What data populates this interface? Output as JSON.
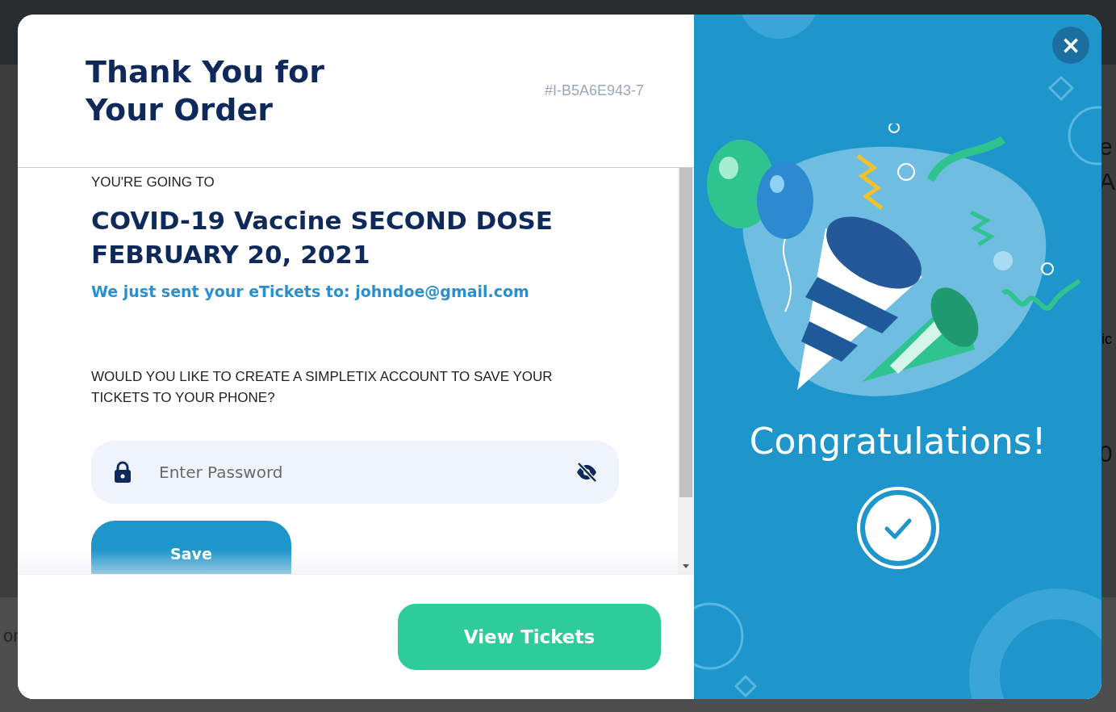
{
  "background_texts": [
    "e",
    "A",
    "ic",
    "0",
    "or"
  ],
  "header": {
    "title_lines": [
      "Thank You for",
      "Your Order"
    ],
    "order_id": "#I-B5A6E943-7"
  },
  "event": {
    "intro": "YOU'RE GOING TO",
    "title_lines": [
      "COVID-19 Vaccine SECOND DOSE",
      "FEBRUARY 20, 2021"
    ],
    "email_note": "We just sent your eTickets to: johndoe@gmail.com"
  },
  "account": {
    "question": "WOULD YOU LIKE TO CREATE A SIMPLETIX ACCOUNT TO SAVE YOUR TICKETS TO YOUR PHONE?",
    "password": {
      "placeholder": "Enter Password"
    },
    "save_button": "Save"
  },
  "footer": {
    "view_button": "View Tickets"
  },
  "celebration": {
    "heading": "Congratulations!",
    "close": "×"
  }
}
